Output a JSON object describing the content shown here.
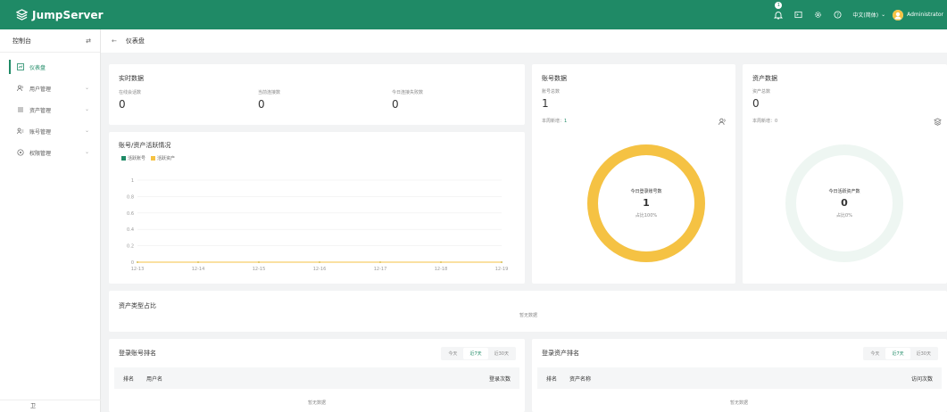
{
  "header": {
    "brand": "JumpServer",
    "notification_count": "1",
    "language": "中文(简体)",
    "username": "Administrator"
  },
  "sidebar": {
    "title": "控制台",
    "items": [
      {
        "label": "仪表盘",
        "icon": "dashboard-icon",
        "active": true
      },
      {
        "label": "用户管理",
        "icon": "users-icon"
      },
      {
        "label": "资产管理",
        "icon": "assets-icon"
      },
      {
        "label": "账号管理",
        "icon": "accounts-icon"
      },
      {
        "label": "权限管理",
        "icon": "permissions-icon"
      }
    ],
    "footer": "卫"
  },
  "breadcrumb": {
    "title": "仪表盘"
  },
  "realtime": {
    "title": "实时数据",
    "stats": [
      {
        "label": "在线会话数",
        "value": "0"
      },
      {
        "label": "当前连接数",
        "value": "0"
      },
      {
        "label": "今日连接失败数",
        "value": "0"
      }
    ]
  },
  "accounts": {
    "title": "账号数据",
    "total_label": "账号总数",
    "total": "1",
    "week_new_label": "本周新增：",
    "week_new": "1",
    "donut_title": "今日登录账号数",
    "donut_value": "1",
    "donut_ratio": "占比100%",
    "donut_fraction": 1.0
  },
  "assets": {
    "title": "资产数据",
    "total_label": "资产总数",
    "total": "0",
    "week_new_label": "本周新增：",
    "week_new": "0",
    "donut_title": "今日活跃资产数",
    "donut_value": "0",
    "donut_ratio": "占比0%",
    "donut_fraction": 0.0
  },
  "activity": {
    "title": "账号/资产活跃情况",
    "legend": [
      "活跃账号",
      "活跃资产"
    ]
  },
  "chart_data": {
    "type": "line",
    "title": "账号/资产活跃情况",
    "x": [
      "12-13",
      "12-14",
      "12-15",
      "12-16",
      "12-17",
      "12-18",
      "12-19"
    ],
    "series": [
      {
        "name": "活跃账号",
        "color": "#1f8a66",
        "values": [
          0,
          0,
          0,
          0,
          0,
          0,
          0
        ]
      },
      {
        "name": "活跃资产",
        "color": "#f5c243",
        "values": [
          0,
          0,
          0,
          0,
          0,
          0,
          0
        ]
      }
    ],
    "y_ticks": [
      "0",
      "0.2",
      "0.4",
      "0.6",
      "0.8",
      "1"
    ],
    "ylim": [
      0,
      1
    ],
    "legend": "top-left",
    "grid": true
  },
  "asset_types": {
    "title": "资产类型占比",
    "empty": "暂无数据"
  },
  "login_accounts": {
    "title": "登录账号排名",
    "tabs": [
      "今天",
      "近7天",
      "近30天"
    ],
    "active_tab": 1,
    "columns": [
      "排名",
      "用户名",
      "登录次数"
    ],
    "empty": "暂无数据"
  },
  "login_assets": {
    "title": "登录资产排名",
    "tabs": [
      "今天",
      "近7天",
      "近30天"
    ],
    "active_tab": 1,
    "columns": [
      "排名",
      "资产名称",
      "访问次数"
    ],
    "empty": "暂无数据"
  },
  "colors": {
    "brand": "#1f8a66",
    "accent": "#f5c243",
    "faint": "#eef6f2"
  }
}
